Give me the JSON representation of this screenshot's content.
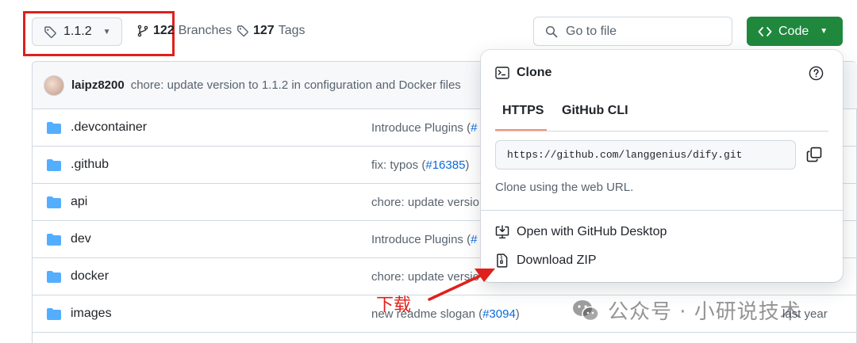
{
  "repo_header": {
    "branch_label": "1.1.2",
    "branches_count": "122",
    "branches_label": "Branches",
    "tags_count": "127",
    "tags_label": "Tags",
    "search_placeholder": "Go to file",
    "code_button_label": "Code"
  },
  "latest_commit": {
    "author": "laipz8200",
    "message": "chore: update version to 1.1.2 in configuration and Docker files"
  },
  "files": [
    {
      "name": ".devcontainer",
      "message": "Introduce Plugins (",
      "link": "#",
      "time": ""
    },
    {
      "name": ".github",
      "message": "fix: typos (",
      "link": "#16385",
      "suffix": ")",
      "time": ""
    },
    {
      "name": "api",
      "message": "chore: update versio",
      "link": "",
      "time": ""
    },
    {
      "name": "dev",
      "message": "Introduce Plugins (",
      "link": "#",
      "time": ""
    },
    {
      "name": "docker",
      "message": "chore: update versio",
      "link": "",
      "time": ""
    },
    {
      "name": "images",
      "message": "new readme slogan (",
      "link": "#3094",
      "suffix": ")",
      "time": "last year"
    }
  ],
  "clone_dropdown": {
    "title": "Clone",
    "tabs": [
      "HTTPS",
      "GitHub CLI"
    ],
    "active_tab": "HTTPS",
    "url": "https://github.com/langgenius/dify.git",
    "hint": "Clone using the web URL.",
    "open_desktop_label": "Open with GitHub Desktop",
    "download_zip_label": "Download ZIP"
  },
  "annotations": {
    "download_label": "下载",
    "watermark": "公众号 · 小研说技术"
  },
  "colors": {
    "code_button": "#1f883d",
    "link": "#0969da",
    "annotation_red": "#e0201c",
    "tab_underline": "#fd8c73"
  }
}
